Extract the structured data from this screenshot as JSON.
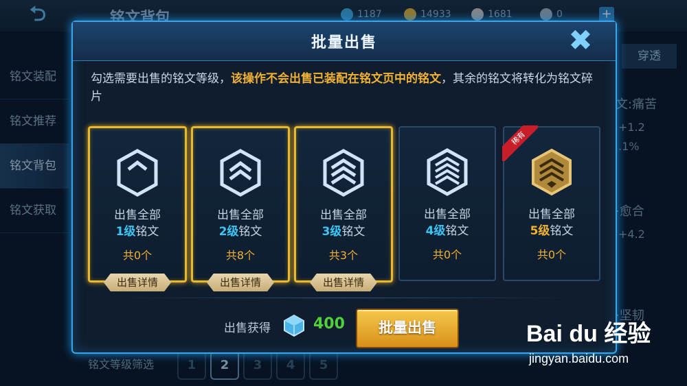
{
  "background": {
    "back_icon": "back-arrow-icon",
    "title": "铭文背包",
    "resources": [
      {
        "value": "1187",
        "color": "#3fa9e0"
      },
      {
        "value": "14933",
        "color": "#e0b23f"
      },
      {
        "value": "1681",
        "color": "#c7c7c7"
      },
      {
        "value": "0",
        "color": "#9fb3c6"
      }
    ],
    "plus_label": "+",
    "sidebar": {
      "items": [
        {
          "label": "铭文装配"
        },
        {
          "label": "铭文推荐"
        },
        {
          "label": "铭文背包"
        },
        {
          "label": "铭文获取"
        }
      ]
    },
    "right_tab": "穿透",
    "right_stats": [
      "文:痛苦",
      "+1.2",
      ".1%",
      "·愈合",
      "+4.2",
      "·坚韧"
    ],
    "filter_label": "铭文等级筛选",
    "filter_levels": [
      "1",
      "2",
      "3",
      "4",
      "5"
    ]
  },
  "modal": {
    "title": "批量出售",
    "close_icon": "close-x-icon",
    "desc_part1": "勾选需要出售的铭文等级，",
    "desc_highlight": "该操作不会出售已装配在铭文页中的铭文",
    "desc_part2": "，其余的铭文将转化为铭文碎片",
    "cards": [
      {
        "line1": "出售全部",
        "level": "1级",
        "suffix": "铭文",
        "count": "共0个",
        "selected": true,
        "detail": "出售详情",
        "rare": ""
      },
      {
        "line1": "出售全部",
        "level": "2级",
        "suffix": "铭文",
        "count": "共8个",
        "selected": true,
        "detail": "出售详情",
        "rare": ""
      },
      {
        "line1": "出售全部",
        "level": "3级",
        "suffix": "铭文",
        "count": "共3个",
        "selected": true,
        "detail": "出售详情",
        "rare": ""
      },
      {
        "line1": "出售全部",
        "level": "4级",
        "suffix": "铭文",
        "count": "共0个",
        "selected": false,
        "detail": "",
        "rare": ""
      },
      {
        "line1": "出售全部",
        "level": "5级",
        "suffix": "铭文",
        "count": "共0个",
        "selected": false,
        "detail": "",
        "rare": "稀有"
      }
    ],
    "gain_label": "出售获得",
    "gain_icon": "crystal-icon",
    "gain_value": "400",
    "sell_button": "批量出售"
  },
  "watermark": {
    "logo": "Bai du 经验",
    "url": "jingyan.baidu.com"
  }
}
